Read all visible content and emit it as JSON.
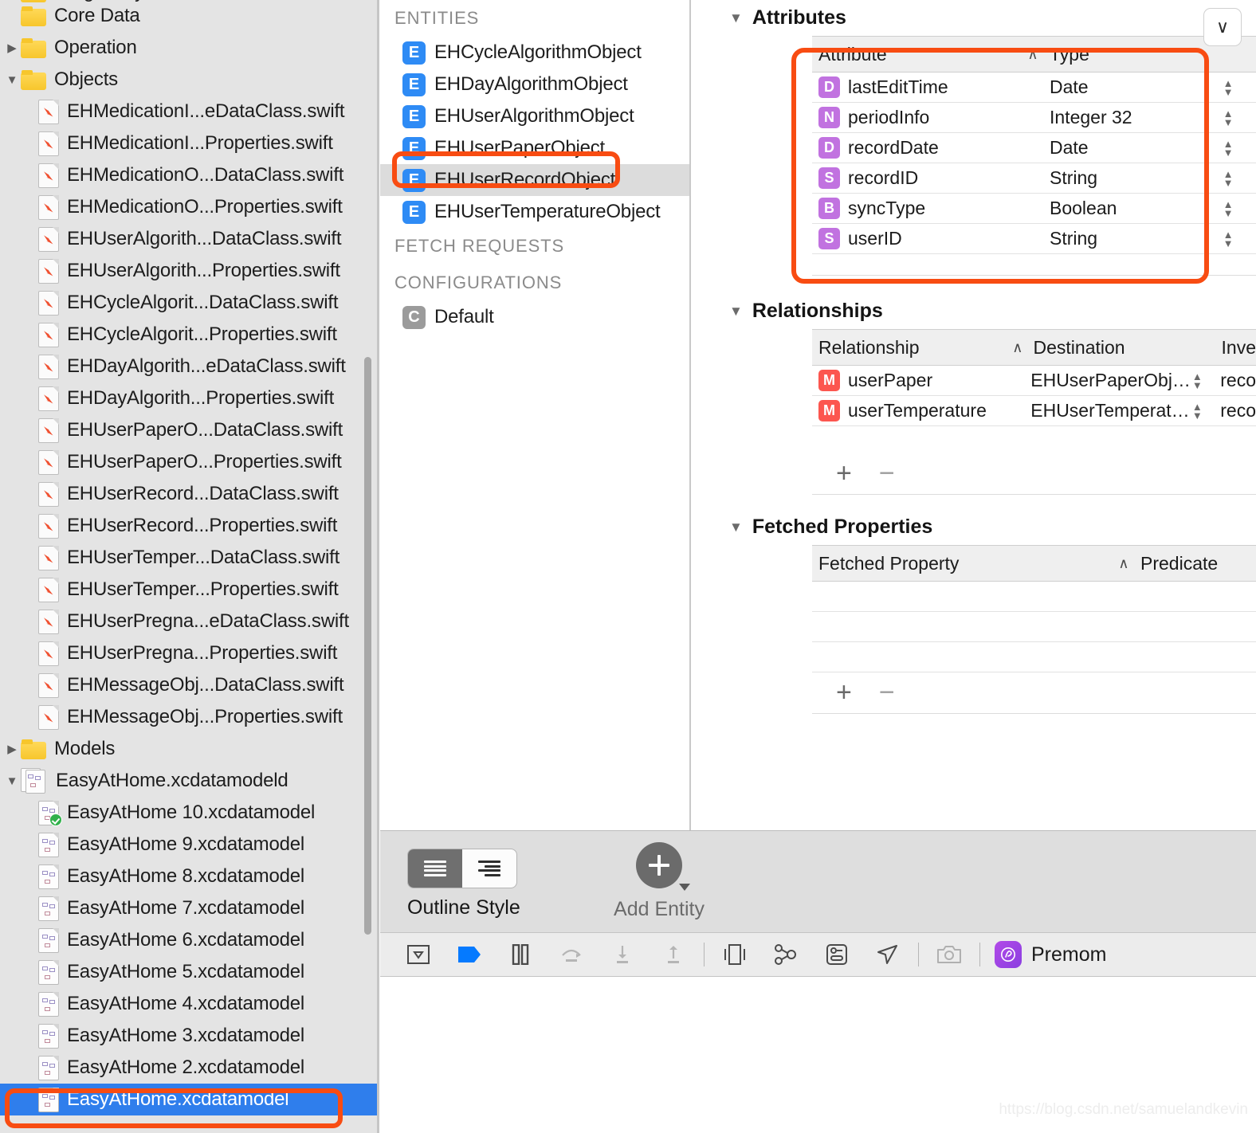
{
  "navigator": {
    "items": [
      {
        "label": "Pregnancy",
        "icon": "folder-icon",
        "indent": 0,
        "twisty": "",
        "clipped": true
      },
      {
        "label": "Core Data",
        "icon": "folder-icon",
        "indent": 0,
        "twisty": ""
      },
      {
        "label": "Operation",
        "icon": "folder-icon",
        "indent": 0,
        "twisty": "closed"
      },
      {
        "label": "Objects",
        "icon": "folder-icon",
        "indent": 0,
        "twisty": "open"
      },
      {
        "label": "EHMedicationI...eDataClass.swift",
        "icon": "swift-file-icon",
        "indent": 1,
        "twisty": ""
      },
      {
        "label": "EHMedicationI...Properties.swift",
        "icon": "swift-file-icon",
        "indent": 1,
        "twisty": ""
      },
      {
        "label": "EHMedicationO...DataClass.swift",
        "icon": "swift-file-icon",
        "indent": 1,
        "twisty": ""
      },
      {
        "label": "EHMedicationO...Properties.swift",
        "icon": "swift-file-icon",
        "indent": 1,
        "twisty": ""
      },
      {
        "label": "EHUserAlgorith...DataClass.swift",
        "icon": "swift-file-icon",
        "indent": 1,
        "twisty": ""
      },
      {
        "label": "EHUserAlgorith...Properties.swift",
        "icon": "swift-file-icon",
        "indent": 1,
        "twisty": ""
      },
      {
        "label": "EHCycleAlgorit...DataClass.swift",
        "icon": "swift-file-icon",
        "indent": 1,
        "twisty": ""
      },
      {
        "label": "EHCycleAlgorit...Properties.swift",
        "icon": "swift-file-icon",
        "indent": 1,
        "twisty": ""
      },
      {
        "label": "EHDayAlgorith...eDataClass.swift",
        "icon": "swift-file-icon",
        "indent": 1,
        "twisty": ""
      },
      {
        "label": "EHDayAlgorith...Properties.swift",
        "icon": "swift-file-icon",
        "indent": 1,
        "twisty": ""
      },
      {
        "label": "EHUserPaperO...DataClass.swift",
        "icon": "swift-file-icon",
        "indent": 1,
        "twisty": ""
      },
      {
        "label": "EHUserPaperO...Properties.swift",
        "icon": "swift-file-icon",
        "indent": 1,
        "twisty": ""
      },
      {
        "label": "EHUserRecord...DataClass.swift",
        "icon": "swift-file-icon",
        "indent": 1,
        "twisty": ""
      },
      {
        "label": "EHUserRecord...Properties.swift",
        "icon": "swift-file-icon",
        "indent": 1,
        "twisty": ""
      },
      {
        "label": "EHUserTemper...DataClass.swift",
        "icon": "swift-file-icon",
        "indent": 1,
        "twisty": ""
      },
      {
        "label": "EHUserTemper...Properties.swift",
        "icon": "swift-file-icon",
        "indent": 1,
        "twisty": ""
      },
      {
        "label": "EHUserPregna...eDataClass.swift",
        "icon": "swift-file-icon",
        "indent": 1,
        "twisty": ""
      },
      {
        "label": "EHUserPregna...Properties.swift",
        "icon": "swift-file-icon",
        "indent": 1,
        "twisty": ""
      },
      {
        "label": "EHMessageObj...DataClass.swift",
        "icon": "swift-file-icon",
        "indent": 1,
        "twisty": ""
      },
      {
        "label": "EHMessageObj...Properties.swift",
        "icon": "swift-file-icon",
        "indent": 1,
        "twisty": ""
      },
      {
        "label": "Models",
        "icon": "folder-icon",
        "indent": 0,
        "twisty": "closed"
      },
      {
        "label": "EasyAtHome.xcdatamodeld",
        "icon": "xcdatamodeld-icon",
        "indent": 0,
        "twisty": "open"
      },
      {
        "label": "EasyAtHome 10.xcdatamodel",
        "icon": "xcdatamodel-icon-current",
        "indent": 1,
        "twisty": ""
      },
      {
        "label": "EasyAtHome 9.xcdatamodel",
        "icon": "xcdatamodel-icon",
        "indent": 1,
        "twisty": ""
      },
      {
        "label": "EasyAtHome 8.xcdatamodel",
        "icon": "xcdatamodel-icon",
        "indent": 1,
        "twisty": ""
      },
      {
        "label": "EasyAtHome 7.xcdatamodel",
        "icon": "xcdatamodel-icon",
        "indent": 1,
        "twisty": ""
      },
      {
        "label": "EasyAtHome 6.xcdatamodel",
        "icon": "xcdatamodel-icon",
        "indent": 1,
        "twisty": ""
      },
      {
        "label": "EasyAtHome 5.xcdatamodel",
        "icon": "xcdatamodel-icon",
        "indent": 1,
        "twisty": ""
      },
      {
        "label": "EasyAtHome 4.xcdatamodel",
        "icon": "xcdatamodel-icon",
        "indent": 1,
        "twisty": ""
      },
      {
        "label": "EasyAtHome 3.xcdatamodel",
        "icon": "xcdatamodel-icon",
        "indent": 1,
        "twisty": ""
      },
      {
        "label": "EasyAtHome 2.xcdatamodel",
        "icon": "xcdatamodel-icon",
        "indent": 1,
        "twisty": ""
      },
      {
        "label": "EasyAtHome.xcdatamodel",
        "icon": "xcdatamodel-icon",
        "indent": 1,
        "twisty": "",
        "selected": true
      }
    ]
  },
  "entity_panel": {
    "sections": [
      {
        "title": "ENTITIES",
        "items": [
          {
            "label": "EHCycleAlgorithmObject",
            "badge": "E"
          },
          {
            "label": "EHDayAlgorithmObject",
            "badge": "E"
          },
          {
            "label": "EHUserAlgorithmObject",
            "badge": "E"
          },
          {
            "label": "EHUserPaperObject",
            "badge": "E"
          },
          {
            "label": "EHUserRecordObject",
            "badge": "E",
            "selected": true
          },
          {
            "label": "EHUserTemperatureObject",
            "badge": "E"
          }
        ]
      },
      {
        "title": "FETCH REQUESTS",
        "items": []
      },
      {
        "title": "CONFIGURATIONS",
        "items": [
          {
            "label": "Default",
            "badge": "C"
          }
        ]
      }
    ]
  },
  "editor": {
    "attributes": {
      "title": "Attributes",
      "columns": {
        "name": "Attribute",
        "type": "Type"
      },
      "sort_indicator": "∧",
      "rows": [
        {
          "badge": "D",
          "name": "lastEditTime",
          "type": "Date"
        },
        {
          "badge": "N",
          "name": "periodInfo",
          "type": "Integer 32"
        },
        {
          "badge": "D",
          "name": "recordDate",
          "type": "Date"
        },
        {
          "badge": "S",
          "name": "recordID",
          "type": "String"
        },
        {
          "badge": "B",
          "name": "syncType",
          "type": "Boolean"
        },
        {
          "badge": "S",
          "name": "userID",
          "type": "String"
        }
      ]
    },
    "relationships": {
      "title": "Relationships",
      "columns": {
        "name": "Relationship",
        "destination": "Destination",
        "inverse": "Inve"
      },
      "sort_indicator": "∧",
      "rows": [
        {
          "badge": "M",
          "name": "userPaper",
          "destination": "EHUserPaperObj…",
          "inverse": "reco"
        },
        {
          "badge": "M",
          "name": "userTemperature",
          "destination": "EHUserTemperat…",
          "inverse": "reco"
        }
      ],
      "add_label": "+",
      "remove_label": "−"
    },
    "fetched_properties": {
      "title": "Fetched Properties",
      "columns": {
        "name": "Fetched Property",
        "predicate": "Predicate"
      },
      "sort_indicator": "∧",
      "rows": [],
      "add_label": "+",
      "remove_label": "−"
    },
    "collapse_icon": "∨"
  },
  "style_bar": {
    "outline_style_label": "Outline Style",
    "add_entity_label": "Add Entity"
  },
  "debug_bar": {
    "app_name": "Premom"
  },
  "watermark": "https://blog.csdn.net/samuelandkevin",
  "colors": {
    "accent_blue": "#2f7eec",
    "entity_badge": "#2e8bf5",
    "attribute_badge": "#c172e0",
    "relationship_badge": "#fc564f",
    "annotation": "#f84c12",
    "folder": "#f7c62c"
  }
}
